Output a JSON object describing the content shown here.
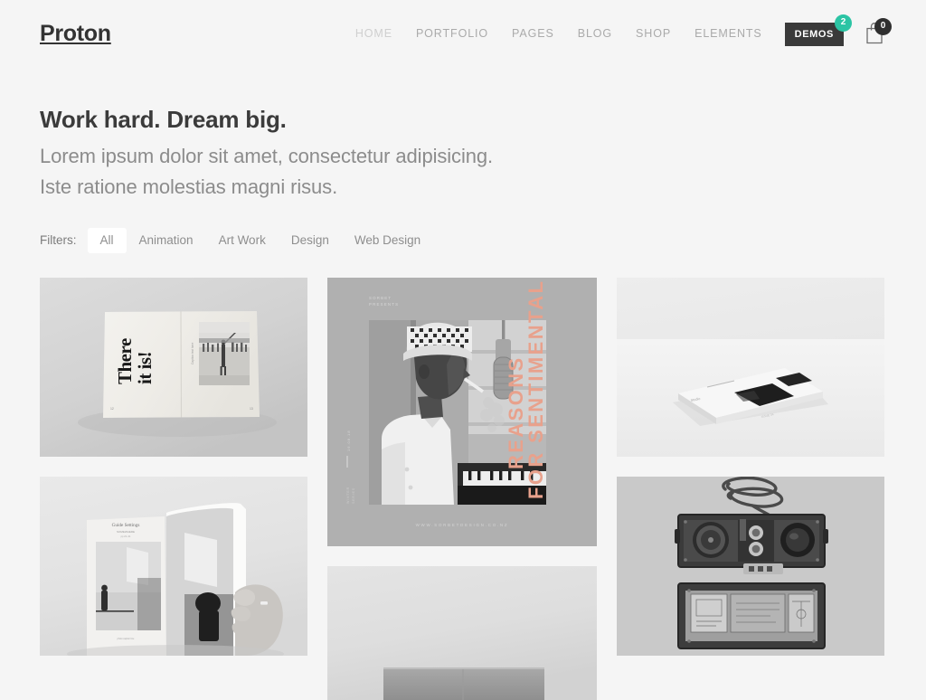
{
  "site": {
    "background_color": "#f5f5f5",
    "logo": "Proton"
  },
  "header": {
    "nav": [
      {
        "label": "HOME",
        "active": true
      },
      {
        "label": "PORTFOLIO",
        "active": false
      },
      {
        "label": "PAGES",
        "active": false
      },
      {
        "label": "BLOG",
        "active": false
      },
      {
        "label": "SHOP",
        "active": false
      },
      {
        "label": "ELEMENTS",
        "active": false
      }
    ],
    "demos_button": {
      "label": "DEMOS",
      "badge_count": "2",
      "badge_color": "#2bc4a4",
      "background_color": "#3a3a3a"
    },
    "cart": {
      "icon": "shopping-bag-icon",
      "badge_count": "0",
      "badge_color": "#2f2f2f"
    }
  },
  "hero": {
    "heading": "Work hard. Dream big.",
    "line1": "Lorem ipsum dolor sit amet, consectetur adipisicing.",
    "line2": "Iste ratione molestias magni risus."
  },
  "filters": {
    "label": "Filters:",
    "items": [
      {
        "label": "All",
        "active": true
      },
      {
        "label": "Animation",
        "active": false
      },
      {
        "label": "Art Work",
        "active": false
      },
      {
        "label": "Design",
        "active": false
      },
      {
        "label": "Web Design",
        "active": false
      }
    ]
  },
  "portfolio": {
    "items": [
      {
        "id": "item-1",
        "type": "open-book-spread",
        "description": "Open magazine spread on gray surface with bold rotated headline",
        "overlay_text": "There it is!",
        "column": 1,
        "row": 1
      },
      {
        "id": "item-2",
        "type": "album-poster",
        "description": "Gray poster with black and white photo of singer in hat at microphone with piano",
        "overlay_text": "FOR SENTIMENTAL REASONS",
        "overlay_color": "#e8a18c",
        "caption_top": "SORBET PRESENTS",
        "caption_side_1": "16.08.18",
        "caption_side_2": "WINTER SERIES",
        "caption_bottom": "WWW.SORBETDESIGN.CO.NZ",
        "column": 2,
        "row": 1
      },
      {
        "id": "item-3",
        "type": "book-on-table",
        "description": "Closed book lying flat on bright white surface with dark abstract cover art",
        "column": 3,
        "row": 1
      },
      {
        "id": "item-4",
        "type": "hand-holding-magazine",
        "description": "Hand holding an open magazine showing black and white architectural interior photos",
        "column": 1,
        "row": 2
      },
      {
        "id": "item-5",
        "type": "vintage-equipment",
        "description": "Vintage equipment case with coiled cable, dials and panels, shot from above",
        "column": 3,
        "row": 2
      },
      {
        "id": "item-6",
        "type": "light-gray-scene",
        "description": "Partially visible light gray interior scene cropped by the viewport",
        "column": 2,
        "row": 2
      }
    ]
  }
}
